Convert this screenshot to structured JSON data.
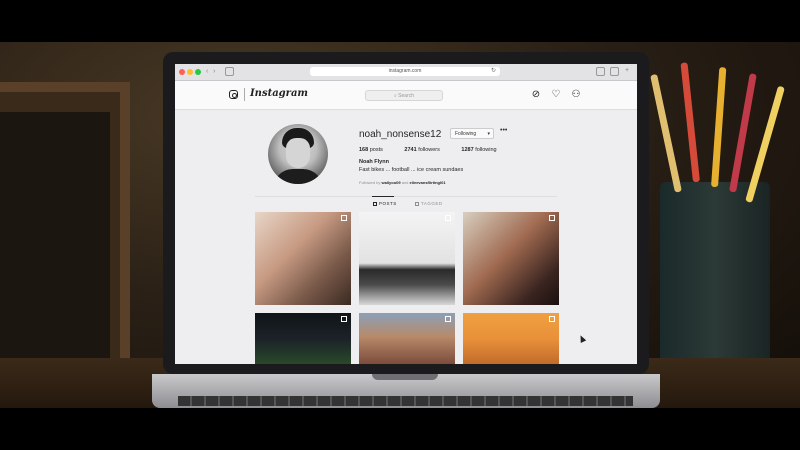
{
  "browser": {
    "url": "instagram.com"
  },
  "instagram": {
    "wordmark": "Instagram",
    "search_placeholder": "Search",
    "nav_icons": [
      "compass-icon",
      "heart-icon",
      "profile-icon"
    ]
  },
  "profile": {
    "username": "noah_nonsense12",
    "follow_button": "Following",
    "posts_count": "168",
    "posts_label": "posts",
    "followers_count": "2741",
    "followers_label": "followers",
    "following_count": "1287",
    "following_label": "following",
    "full_name": "Noah Flynn",
    "bio": "Fast bikes ... football ... ice cream sundaes",
    "followed_by_prefix": "Followed by",
    "followed_by_user1": "wallyoo09",
    "followed_by_and": "and",
    "followed_by_user2": "elleevansflirtingl01"
  },
  "tabs": [
    {
      "label": "POSTS",
      "active": true
    },
    {
      "label": "TAGGED",
      "active": false
    }
  ],
  "colors": {
    "ig_text": "#262626",
    "ig_muted": "#8e8e8e",
    "ig_background": "#fafafa"
  }
}
